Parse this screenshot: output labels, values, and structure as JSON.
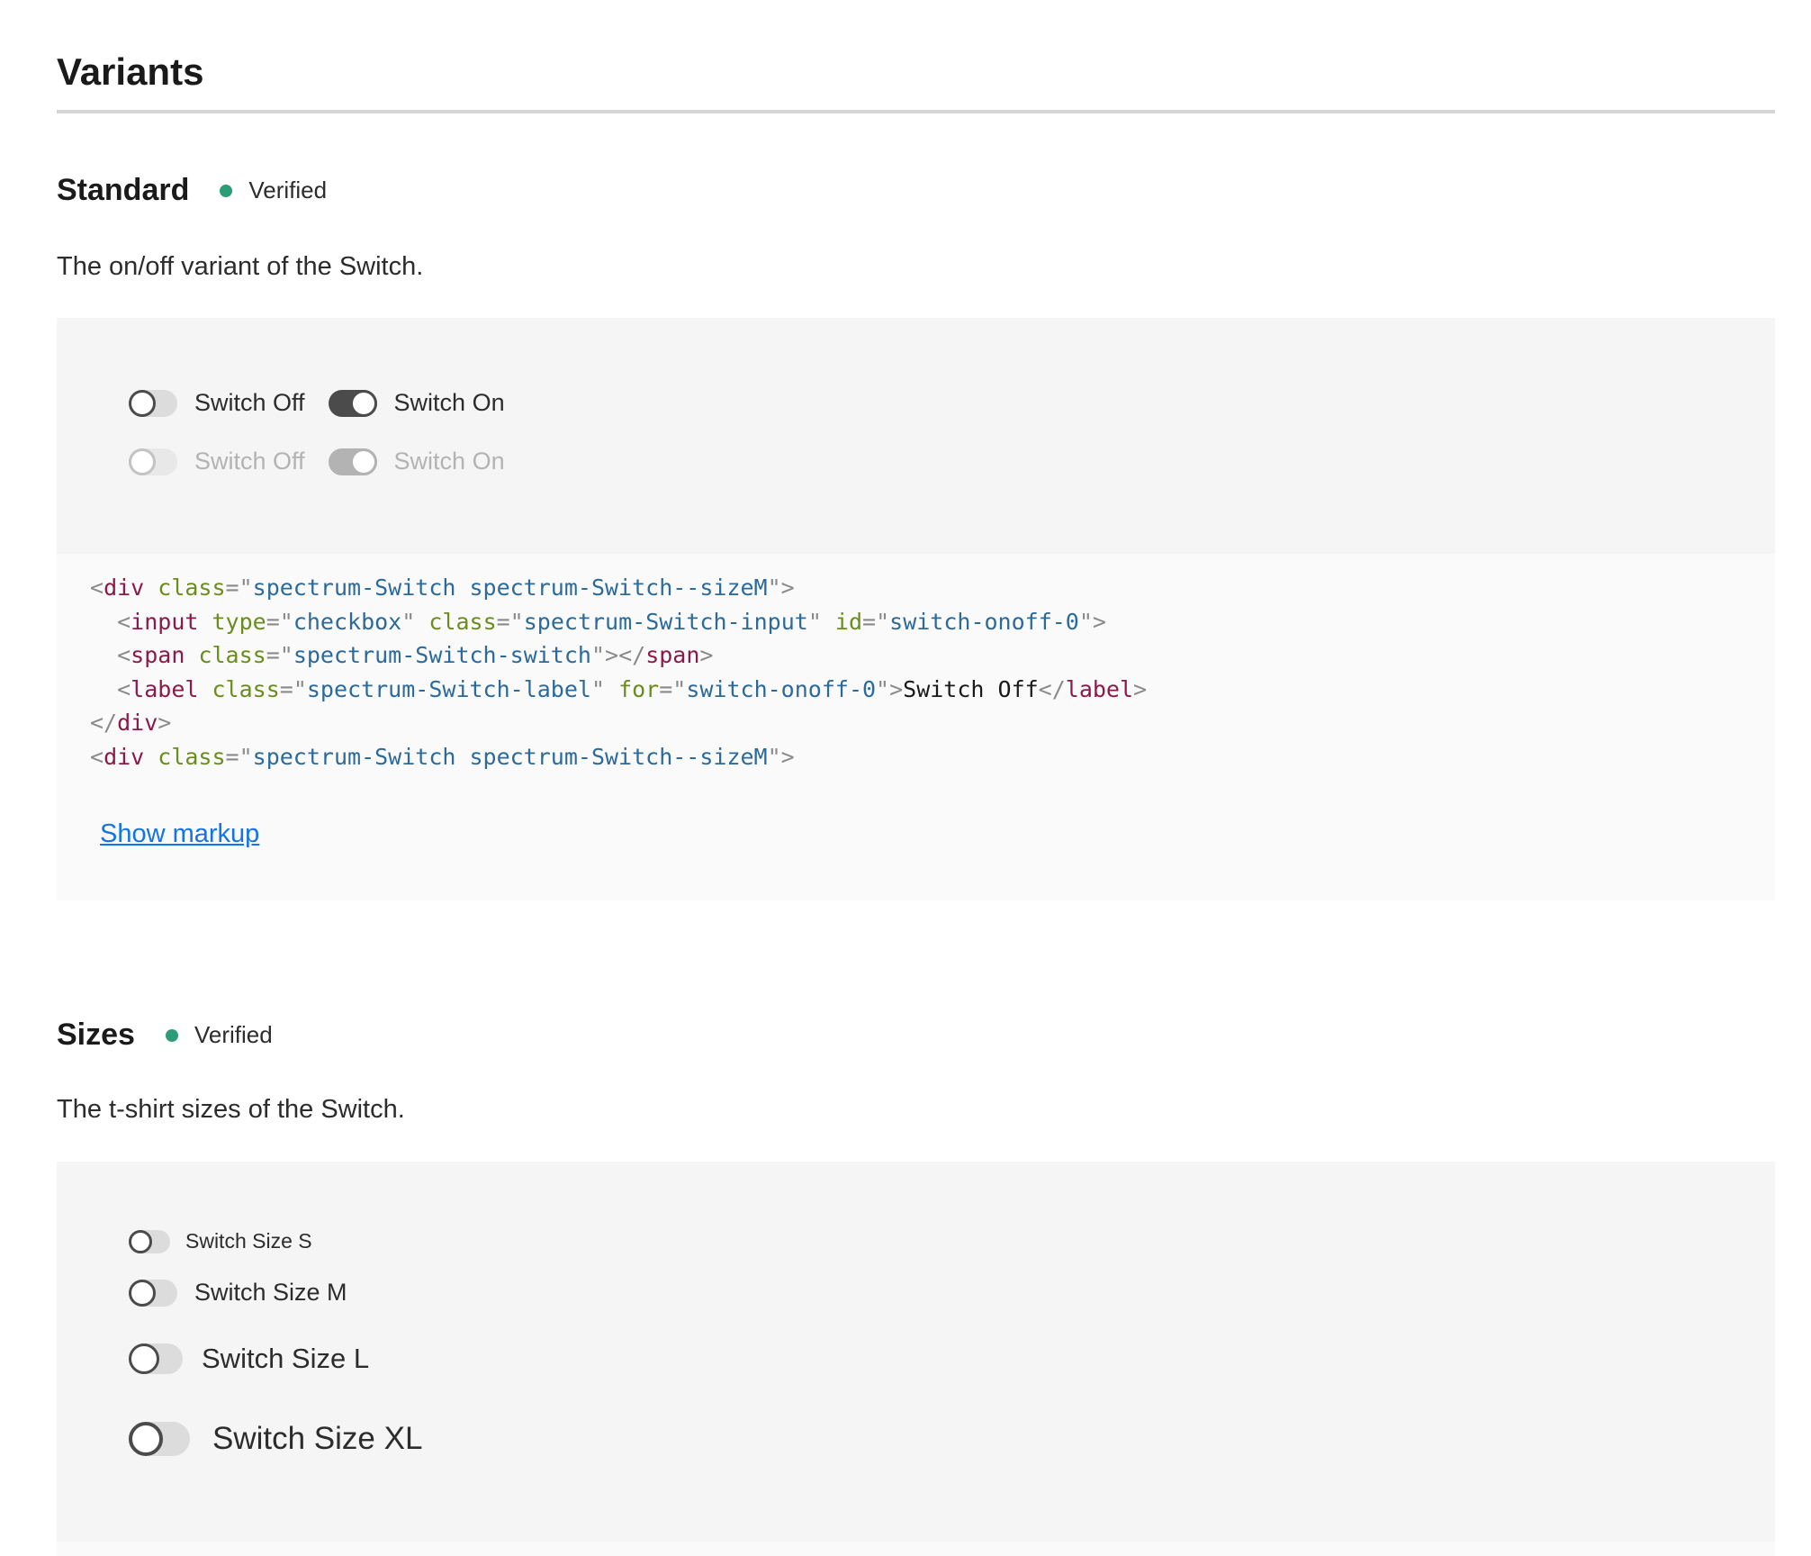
{
  "page": {
    "title": "Variants"
  },
  "colors": {
    "verified": "#2d9d78",
    "link": "#1473e6",
    "switch_on": "#4b4b4b"
  },
  "standard": {
    "title": "Standard",
    "status": "Verified",
    "description": "The on/off variant of the Switch.",
    "switches": [
      {
        "label": "Switch Off",
        "checked": false,
        "disabled": false
      },
      {
        "label": "Switch On",
        "checked": true,
        "disabled": false
      },
      {
        "label": "Switch Off",
        "checked": false,
        "disabled": true
      },
      {
        "label": "Switch On",
        "checked": true,
        "disabled": true
      }
    ],
    "code": {
      "tag_div": "div",
      "tag_input": "input",
      "tag_span": "span",
      "tag_label": "label",
      "attr_class": "class",
      "attr_type": "type",
      "attr_id": "id",
      "attr_for": "for",
      "val_switch_class": "spectrum-Switch spectrum-Switch--sizeM",
      "val_checkbox": "checkbox",
      "val_input_class": "spectrum-Switch-input",
      "val_id": "switch-onoff-0",
      "val_switch_switch": "spectrum-Switch-switch",
      "val_label_class": "spectrum-Switch-label",
      "label_text": "Switch Off"
    },
    "show_markup": "Show markup"
  },
  "sizes": {
    "title": "Sizes",
    "status": "Verified",
    "description": "The t-shirt sizes of the Switch.",
    "switches": [
      {
        "label": "Switch Size S"
      },
      {
        "label": "Switch Size M"
      },
      {
        "label": "Switch Size L"
      },
      {
        "label": "Switch Size XL"
      }
    ]
  }
}
